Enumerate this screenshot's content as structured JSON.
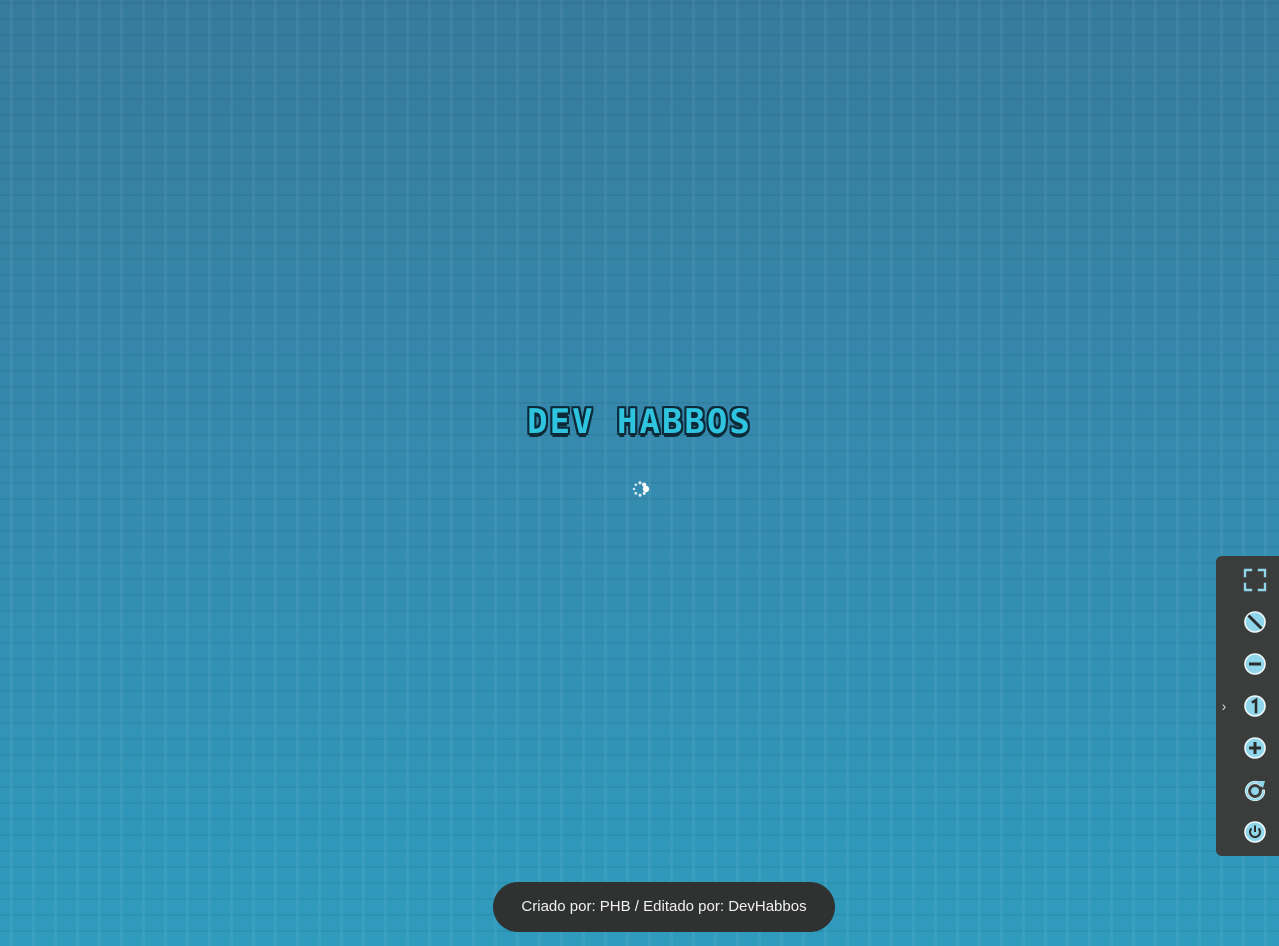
{
  "loader": {
    "logo_text": "DEV HABBOS"
  },
  "toolbar": {
    "toggle_glyph": "›",
    "buttons": [
      {
        "icon": "fullscreen-icon"
      },
      {
        "icon": "block-icon"
      },
      {
        "icon": "zoom-out-icon"
      },
      {
        "icon": "zoom-reset-icon"
      },
      {
        "icon": "zoom-in-icon"
      },
      {
        "icon": "reload-icon"
      },
      {
        "icon": "power-icon"
      }
    ]
  },
  "footer": {
    "credits": "Criado por: PHB / Editado por: DevHabbos"
  },
  "colors": {
    "background_top": "#367b9c",
    "background_bottom": "#2f9bbd",
    "logo_fill": "#2ec4df",
    "toolbar_bg": "#3a3d3b",
    "icon_accent": "#8fd6ea",
    "footer_bg": "#303232"
  }
}
